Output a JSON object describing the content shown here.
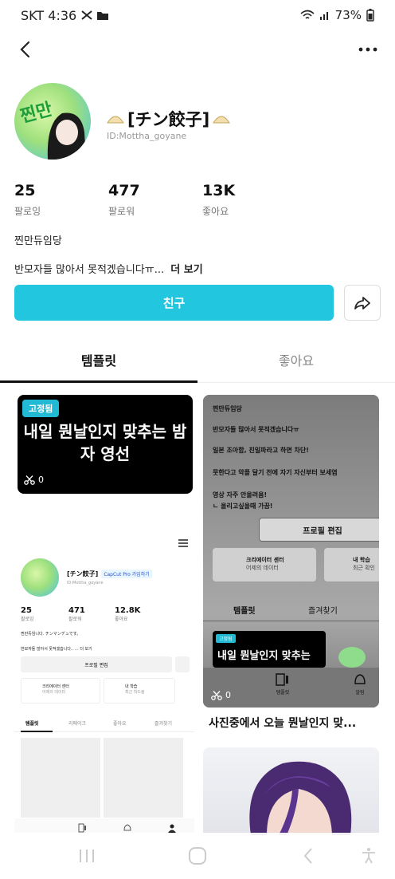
{
  "status_bar": {
    "carrier_time": "SKT 4:36",
    "battery": "73%"
  },
  "profile": {
    "nickname": "[チン餃子]",
    "handle": "ID:Mottha_goyane",
    "stats": [
      {
        "value": "25",
        "label": "팔로잉"
      },
      {
        "value": "477",
        "label": "팔로워"
      },
      {
        "value": "13K",
        "label": "좋아요"
      }
    ],
    "bio_line1": "찐만듀임당",
    "bio_line2": "반모자들 많아서 못적겠습니다ㅠ...",
    "bio_more": "더 보기",
    "friend_button": "친구"
  },
  "tabs": {
    "templates": "템플릿",
    "likes": "좋아요"
  },
  "cards": {
    "pinned": {
      "badge": "고정됨",
      "title": "내일 뭔날인지 맞추는 밤자 영선",
      "uses": "0"
    },
    "preview_left": {
      "nickname": "[チン餃子]",
      "capcut_badge": "CapCut Pro 가입하기",
      "id": "ID:Mottha_goyane",
      "stats": [
        {
          "value": "25",
          "label": "팔로잉"
        },
        {
          "value": "471",
          "label": "팔로워"
        },
        {
          "value": "12.8K",
          "label": "좋아요"
        }
      ],
      "bio1": "찐만듀임니다. チンマンデュです。",
      "bio2": "반모자들 많아서 못적겠습니다.. … 더 보기",
      "edit": "프로필 편집",
      "creator": "크리에이터 센터",
      "creator_sub": "어제의 데이터",
      "learn": "내 학습",
      "learn_sub": "최근 학드림",
      "tab1": "템플릿",
      "tab2": "리메이크",
      "tab3": "좋아요",
      "tab4": "즐겨찾기"
    },
    "preview_right": {
      "line1": "찐만듀임당",
      "line2": "반모자들 많아서 못적겠습니다ㅠ",
      "line3": "일본 조아함, 친일파라고 하면 차단!",
      "line4": "뭇한다고 악플 달기 전에 자기 자신부터 보세염",
      "line5": "영상 자주 안올려욤!",
      "line6": "ㄴ 올리고싶을때 가끔!",
      "edit": "프로필 편집",
      "creator": "크리에이터 센터",
      "creator_sub": "어제의 데이터",
      "learn": "내 학습",
      "learn_sub": "최근 확인",
      "tab1": "템플릿",
      "tab2": "즐겨찾기",
      "badge": "고정됨",
      "black_title": "내일 뭔날인지 맞추는",
      "nav1": "템플릿",
      "nav2": "알림",
      "uses": "0",
      "caption": "사진중에서 오늘 뭔날인지 맞..."
    }
  },
  "icons": {
    "back": "chevron-left-icon",
    "more": "more-horizontal-icon",
    "share": "share-arrow-icon",
    "scissors": "scissors-icon"
  },
  "colors": {
    "accent": "#22c6de",
    "badge": "#21b9d3"
  }
}
